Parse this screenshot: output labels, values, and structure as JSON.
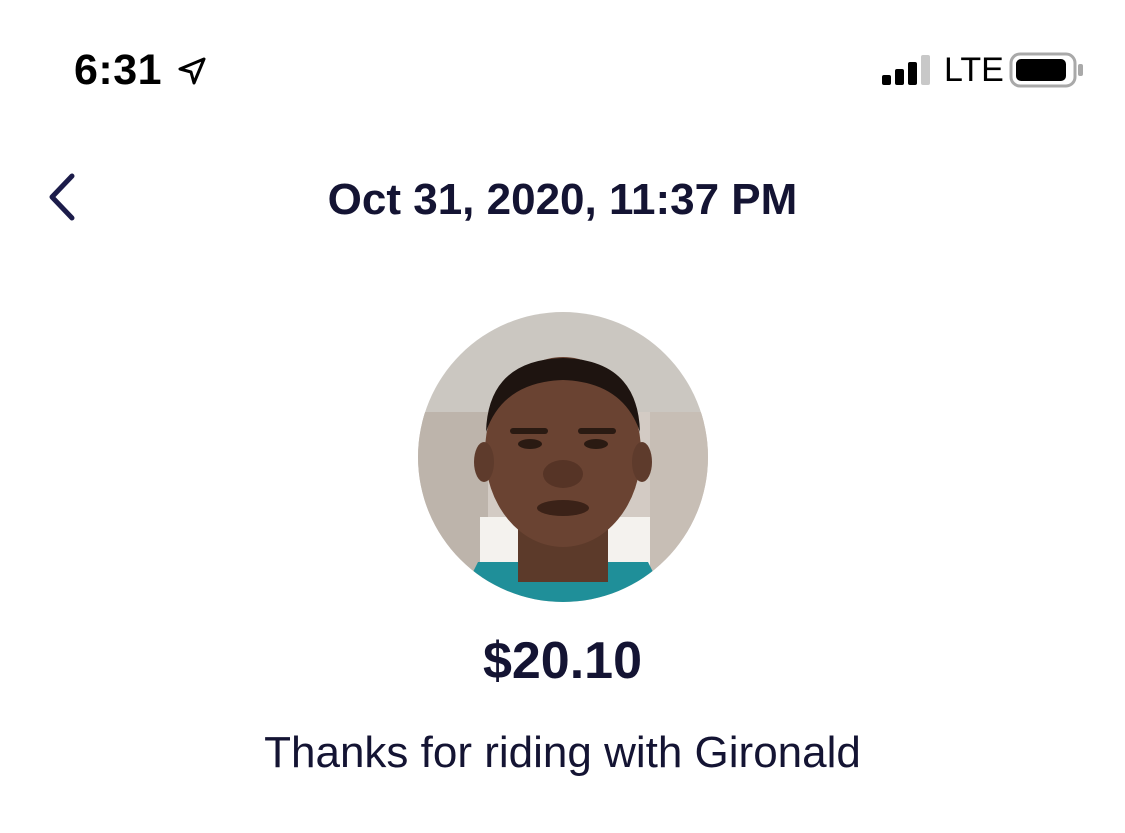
{
  "status_bar": {
    "time": "6:31",
    "network": "LTE",
    "location_icon": "location-arrow-icon",
    "signal_icon": "cellular-signal-icon",
    "battery_icon": "battery-icon"
  },
  "header": {
    "back_icon": "chevron-left-icon",
    "title": "Oct 31, 2020, 11:37 PM"
  },
  "ride": {
    "driver_avatar": "driver-photo",
    "amount": "$20.10",
    "message": "Thanks for riding with Gironald"
  },
  "colors": {
    "text_primary": "#141433",
    "background": "#ffffff"
  }
}
